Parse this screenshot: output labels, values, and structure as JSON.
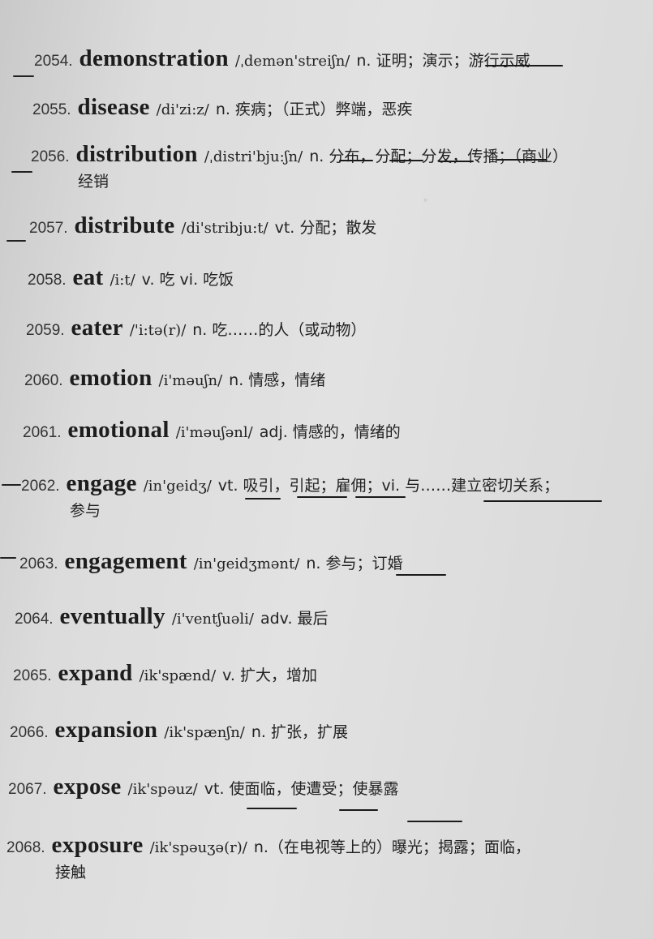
{
  "entries": [
    {
      "num": "2054.",
      "word": "demonstration",
      "ipa": "/ˌdemən'streiʃn/",
      "def": "n. 证明；演示；游行示威"
    },
    {
      "num": "2055.",
      "word": "disease",
      "ipa": "/di'zi:z/",
      "def": "n. 疾病；（正式）弊端，恶疾"
    },
    {
      "num": "2056.",
      "word": "distribution",
      "ipa": "/ˌdistri'bju:ʃn/",
      "def": "n. 分布，分配；分发，传播；（商业）",
      "def2": "经销"
    },
    {
      "num": "2057.",
      "word": "distribute",
      "ipa": "/di'stribju:t/",
      "def": "vt. 分配；散发"
    },
    {
      "num": "2058.",
      "word": "eat",
      "ipa": "/i:t/",
      "def": "v. 吃 vi. 吃饭"
    },
    {
      "num": "2059.",
      "word": "eater",
      "ipa": "/'i:tə(r)/",
      "def": "n. 吃……的人（或动物）"
    },
    {
      "num": "2060.",
      "word": "emotion",
      "ipa": "/i'məuʃn/",
      "def": "n. 情感，情绪"
    },
    {
      "num": "2061.",
      "word": "emotional",
      "ipa": "/i'məuʃənl/",
      "def": "adj. 情感的，情绪的"
    },
    {
      "num": "2062.",
      "word": "engage",
      "ipa": "/in'geidʒ/",
      "def": "vt. 吸引，引起；雇佣；vi. 与……建立密切关系；",
      "def2": "参与"
    },
    {
      "num": "2063.",
      "word": "engagement",
      "ipa": "/in'geidʒmənt/",
      "def": "n. 参与；订婚"
    },
    {
      "num": "2064.",
      "word": "eventually",
      "ipa": "/i'ventʃuəli/",
      "def": "adv. 最后"
    },
    {
      "num": "2065.",
      "word": "expand",
      "ipa": "/ik'spænd/",
      "def": "v. 扩大，增加"
    },
    {
      "num": "2066.",
      "word": "expansion",
      "ipa": "/ik'spænʃn/",
      "def": "n. 扩张，扩展"
    },
    {
      "num": "2067.",
      "word": "expose",
      "ipa": "/ik'spəuz/",
      "def": "vt. 使面临，使遭受；使暴露"
    },
    {
      "num": "2068.",
      "word": "exposure",
      "ipa": "/ik'spəuʒə(r)/",
      "def": "n.（在电视等上的）曝光；揭露；面临，",
      "def2": "接触"
    }
  ]
}
